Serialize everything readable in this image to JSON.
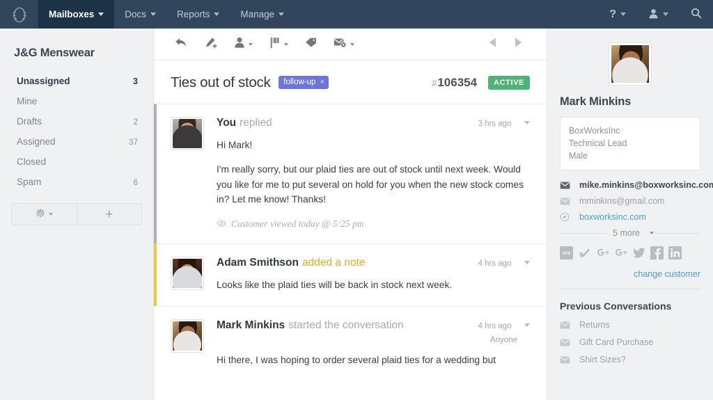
{
  "navbar": {
    "logo_icon": "laurel-wreath-logo",
    "items": [
      {
        "label": "Mailboxes",
        "caret": true,
        "active": true
      },
      {
        "label": "Docs",
        "caret": true,
        "active": false
      },
      {
        "label": "Reports",
        "caret": true,
        "active": false
      },
      {
        "label": "Manage",
        "caret": true,
        "active": false
      }
    ],
    "right": [
      {
        "icon": "help-icon",
        "glyph": "?",
        "caret": true
      },
      {
        "icon": "user-icon",
        "caret": true
      },
      {
        "icon": "search-icon",
        "caret": false
      }
    ]
  },
  "sidebar": {
    "mailbox_title": "J&G Menswear",
    "folders": [
      {
        "label": "Unassigned",
        "count": "3",
        "active": true
      },
      {
        "label": "Mine",
        "count": "",
        "active": false
      },
      {
        "label": "Drafts",
        "count": "2",
        "active": false
      },
      {
        "label": "Assigned",
        "count": "37",
        "active": false
      },
      {
        "label": "Closed",
        "count": "",
        "active": false
      },
      {
        "label": "Spam",
        "count": "6",
        "active": false
      }
    ],
    "buttons": [
      {
        "icon": "gear-icon",
        "caret": true
      },
      {
        "icon": "plus-icon",
        "glyph": "+",
        "caret": false
      }
    ]
  },
  "toolbar": {
    "buttons": [
      {
        "icon": "reply-icon",
        "caret": false
      },
      {
        "icon": "add-note-icon",
        "caret": false
      },
      {
        "icon": "assign-user-icon",
        "caret": true
      },
      {
        "icon": "status-flag-icon",
        "caret": true
      },
      {
        "icon": "tag-icon",
        "caret": false
      },
      {
        "icon": "move-mailbox-icon",
        "caret": true
      }
    ],
    "prev_icon": "previous-conversation-icon",
    "next_icon": "next-conversation-icon"
  },
  "conversation": {
    "title": "Ties out of stock",
    "tag": {
      "label": "follow-up",
      "remove": "×",
      "color": "#6e74d8"
    },
    "hash": "#",
    "number": "106354",
    "status": {
      "label": "ACTIVE",
      "color": "#4cb374"
    }
  },
  "threads": [
    {
      "kind": "reply",
      "avatar": "face-you",
      "author": "You",
      "action": "replied",
      "ago": "3 hrs ago",
      "assignee": "",
      "paragraphs": [
        "Hi Mark!",
        "I'm really sorry, but our plaid ties are out of stock until next week. Would you like for me to put several on hold for you when the new stock comes in? Let me know! Thanks!"
      ],
      "viewed": "Customer viewed today @ 5:25 pm"
    },
    {
      "kind": "note",
      "avatar": "face-adam",
      "author": "Adam Smithson",
      "action": "added a note",
      "ago": "4 hrs ago",
      "assignee": "",
      "paragraphs": [
        "Looks like the plaid ties will be back in stock next week."
      ],
      "viewed": ""
    },
    {
      "kind": "start",
      "avatar": "face-mark",
      "author": "Mark Minkins",
      "action": "started the conversation",
      "ago": "4 hrs ago",
      "assignee": "Anyone",
      "paragraphs": [
        "Hi there, I was hoping to order several plaid ties for a wedding but"
      ],
      "viewed": ""
    }
  ],
  "customer": {
    "photo": "face-mark",
    "name": "Mark Minkins",
    "details": [
      "BoxWorksInc",
      "Technical Lead",
      "Male"
    ],
    "contacts": [
      {
        "icon": "envelope-icon",
        "value": "mike.minkins@boxworksinc.com",
        "style": "primary"
      },
      {
        "icon": "envelope-icon",
        "value": "mminkins@gmail.com",
        "style": "secondary"
      },
      {
        "icon": "compass-icon",
        "value": "boxworksinc.com",
        "style": "link"
      }
    ],
    "more_label": "5 more",
    "socials": [
      {
        "icon": "aboutme-icon",
        "glyph": "me"
      },
      {
        "icon": "checkmark-icon",
        "glyph": ""
      },
      {
        "icon": "google-plus-icon",
        "glyph": "g"
      },
      {
        "icon": "google-plus-2-icon",
        "glyph": "g"
      },
      {
        "icon": "twitter-icon",
        "glyph": ""
      },
      {
        "icon": "facebook-icon",
        "glyph": "f"
      },
      {
        "icon": "linkedin-icon",
        "glyph": "in"
      }
    ],
    "change_customer": "change customer"
  },
  "previous": {
    "title": "Previous Conversations",
    "items": [
      {
        "icon": "envelope-icon",
        "label": "Returns"
      },
      {
        "icon": "envelope-icon",
        "label": "Gift Card Purchase"
      },
      {
        "icon": "envelope-icon",
        "label": "Shirt Sizes?"
      }
    ]
  }
}
